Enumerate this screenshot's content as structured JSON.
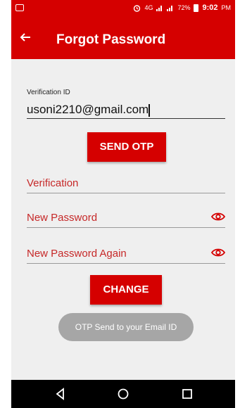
{
  "status_bar": {
    "signal_label": "4G",
    "battery_percent": "72%",
    "time": "9:02",
    "ampm": "PM"
  },
  "app_bar": {
    "title": "Forgot Password",
    "back_icon": "arrow-back-icon"
  },
  "form": {
    "verification_id_label": "Verification ID",
    "verification_id_value": "usoni2210@gmail.com",
    "send_otp_label": "SEND OTP",
    "verification_placeholder": "Verification",
    "new_password_placeholder": "New Password",
    "new_password_again_placeholder": "New Password Again",
    "change_label": "CHANGE"
  },
  "toast": {
    "message": "OTP Send to your Email ID"
  },
  "colors": {
    "primary": "#d50000",
    "hint": "#c62828"
  },
  "nav_bar": {
    "icons": [
      "back-triangle-icon",
      "home-circle-icon",
      "recents-square-icon"
    ]
  }
}
